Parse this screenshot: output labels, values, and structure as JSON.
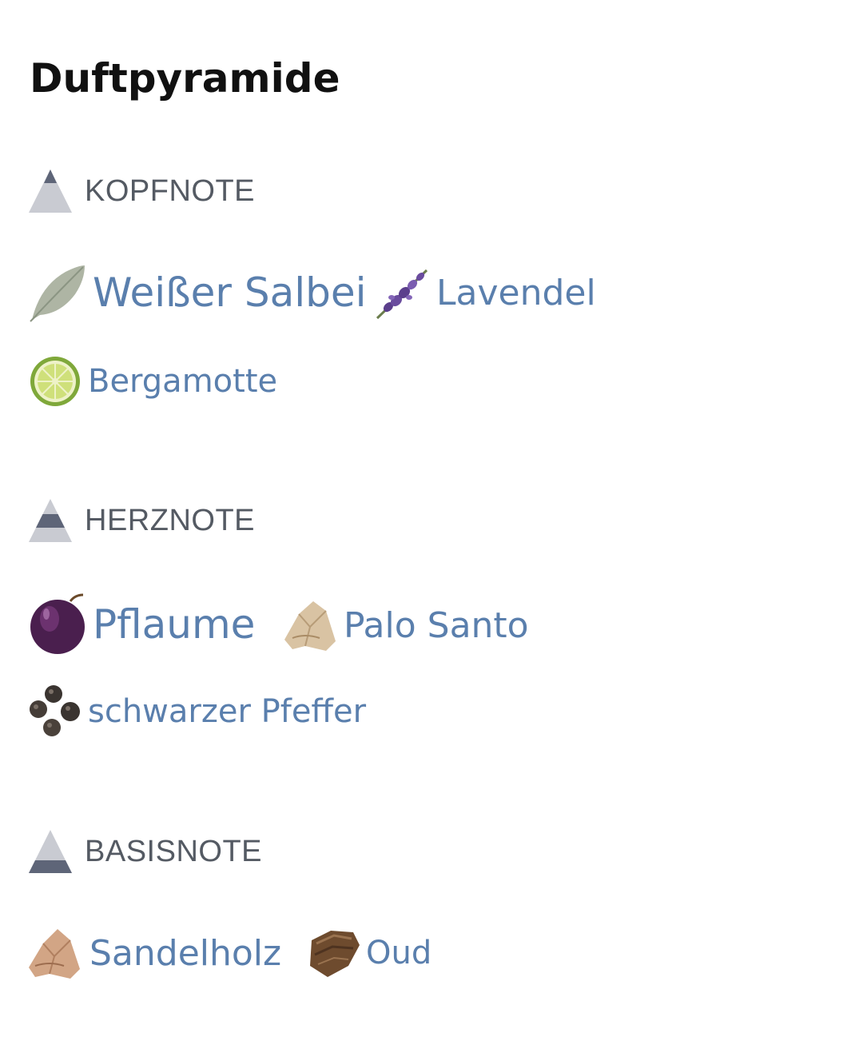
{
  "title": "Duftpyramide",
  "sections": [
    {
      "label": "KOPFNOTE",
      "notes": [
        {
          "label": "Weißer Salbei",
          "icon": "sage-leaf-icon"
        },
        {
          "label": "Lavendel",
          "icon": "lavender-icon"
        },
        {
          "label": "Bergamotte",
          "icon": "bergamot-icon"
        }
      ]
    },
    {
      "label": "HERZNOTE",
      "notes": [
        {
          "label": "Pflaume",
          "icon": "plum-icon"
        },
        {
          "label": "Palo Santo",
          "icon": "palo-santo-icon"
        },
        {
          "label": "schwarzer Pfeffer",
          "icon": "black-pepper-icon"
        }
      ]
    },
    {
      "label": "BASISNOTE",
      "notes": [
        {
          "label": "Sandelholz",
          "icon": "sandalwood-icon"
        },
        {
          "label": "Oud",
          "icon": "oud-icon"
        }
      ]
    }
  ],
  "colors": {
    "title": "#111111",
    "section_label": "#545a63",
    "note_link": "#5a7fad",
    "pyramid_light": "#c9cbd2",
    "pyramid_dark": "#5e6578"
  }
}
